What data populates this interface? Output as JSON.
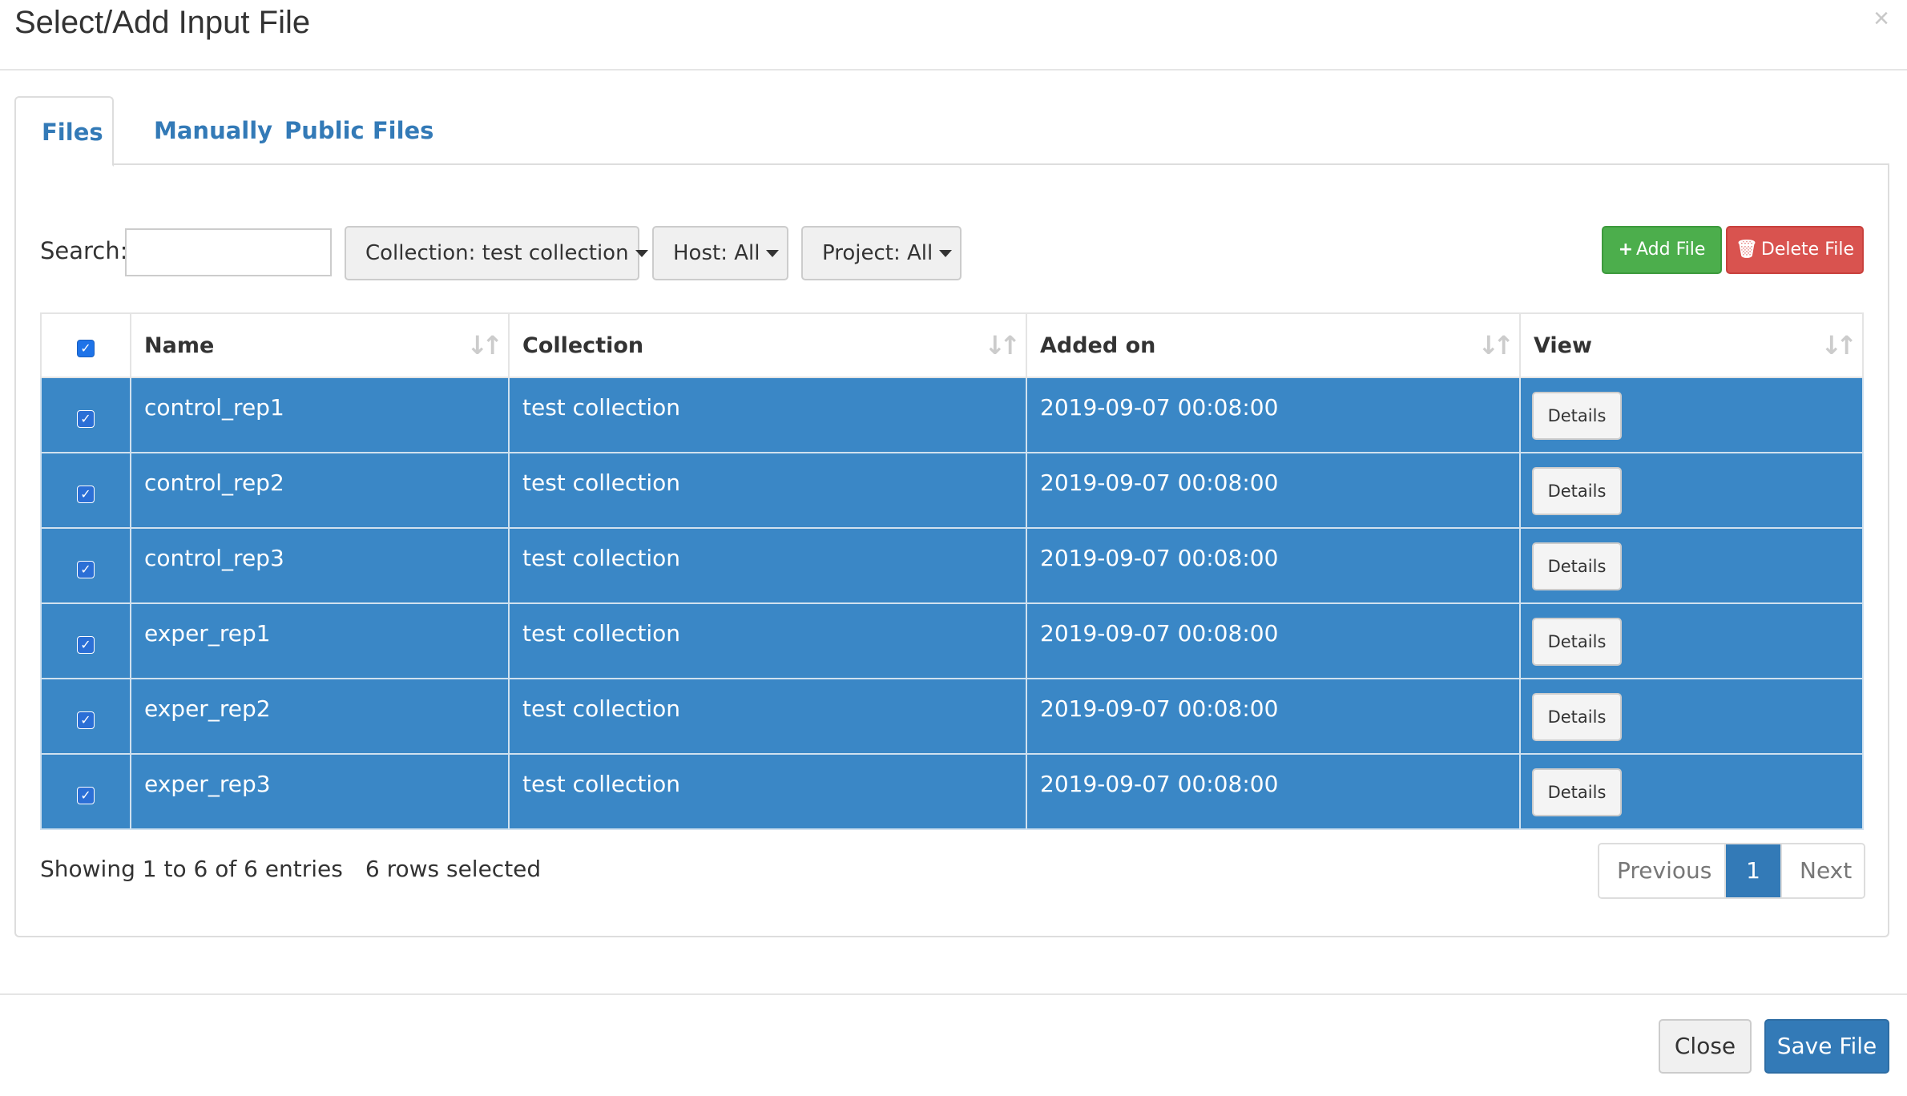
{
  "modal": {
    "title": "Select/Add Input File",
    "close_glyph": "×"
  },
  "tabs": [
    {
      "label": "Files",
      "active": true
    },
    {
      "label": "Manually",
      "active": false
    },
    {
      "label": "Public Files",
      "active": false
    }
  ],
  "toolbar": {
    "search_label": "Search:",
    "search_value": "",
    "collection_filter": "Collection: test collection",
    "host_filter": "Host: All",
    "project_filter": "Project: All",
    "add_label": "Add File",
    "add_icon": "plus-icon",
    "delete_label": "Delete File",
    "delete_icon": "trash-icon"
  },
  "table": {
    "headers": [
      "Name",
      "Collection",
      "Added on",
      "View"
    ],
    "select_all_checked": true,
    "rows": [
      {
        "name": "control_rep1",
        "collection": "test collection",
        "added_on": "2019-09-07 00:08:00",
        "view": "Details",
        "selected": true
      },
      {
        "name": "control_rep2",
        "collection": "test collection",
        "added_on": "2019-09-07 00:08:00",
        "view": "Details",
        "selected": true
      },
      {
        "name": "control_rep3",
        "collection": "test collection",
        "added_on": "2019-09-07 00:08:00",
        "view": "Details",
        "selected": true
      },
      {
        "name": "exper_rep1",
        "collection": "test collection",
        "added_on": "2019-09-07 00:08:00",
        "view": "Details",
        "selected": true
      },
      {
        "name": "exper_rep2",
        "collection": "test collection",
        "added_on": "2019-09-07 00:08:00",
        "view": "Details",
        "selected": true
      },
      {
        "name": "exper_rep3",
        "collection": "test collection",
        "added_on": "2019-09-07 00:08:00",
        "view": "Details",
        "selected": true
      }
    ]
  },
  "status": {
    "showing": "Showing 1 to 6 of 6 entries",
    "selected": "6 rows selected"
  },
  "pagination": {
    "previous": "Previous",
    "current": "1",
    "next": "Next"
  },
  "footer": {
    "close_label": "Close",
    "save_label": "Save File"
  },
  "colors": {
    "selected_row": "#3a87c6",
    "primary": "#337ab7",
    "success": "#4cae4c",
    "danger": "#d9534f"
  }
}
